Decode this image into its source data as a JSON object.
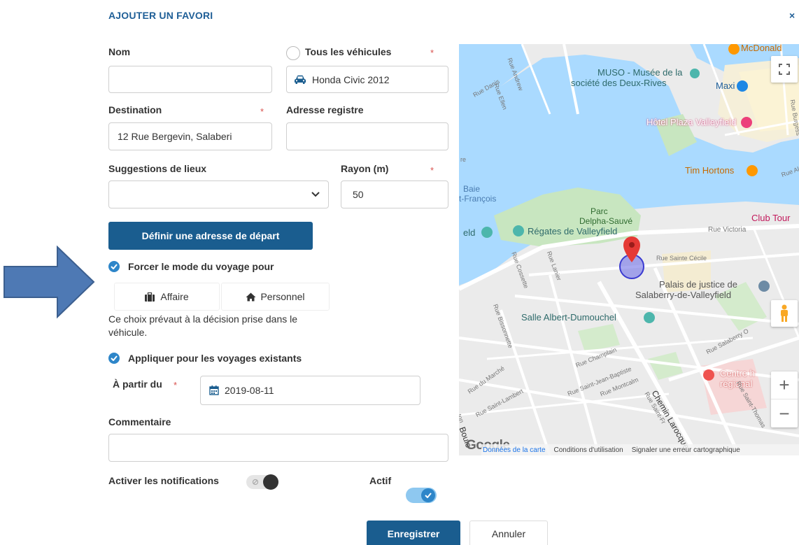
{
  "dialog": {
    "title": "AJOUTER UN FAVORI",
    "close_symbol": "×"
  },
  "form": {
    "name_label": "Nom",
    "name_value": "",
    "all_vehicles_label": "Tous les véhicules",
    "vehicle_value": "Honda Civic 2012",
    "destination_label": "Destination",
    "destination_value": "12 Rue Bergevin, Salaberi",
    "register_address_label": "Adresse registre",
    "register_address_value": "",
    "place_suggestions_label": "Suggestions de lieux",
    "place_suggestions_value": "",
    "radius_label": "Rayon (m)",
    "radius_value": "50",
    "required_mark": "*",
    "set_start_address_button": "Définir une adresse de départ",
    "force_trip_mode_label": "Forcer le mode du voyage pour",
    "trip_mode_business": "Affaire",
    "trip_mode_personal": "Personnel",
    "override_note": "Ce choix prévaut à la décision prise dans le véhicule.",
    "apply_existing_label": "Appliquer pour les voyages existants",
    "from_date_label": "À partir du",
    "from_date_value": "2019-08-11",
    "comment_label": "Commentaire",
    "comment_value": "",
    "notifications_label": "Activer les notifications",
    "active_label": "Actif"
  },
  "footer": {
    "save_button": "Enregistrer",
    "cancel_button": "Annuler"
  },
  "map": {
    "labels": {
      "muso": "MUSO - Musée de la",
      "muso2": "société des Deux-Rives",
      "maxi": "Maxi",
      "mcdonald": "McDonald",
      "hotel": "Hôtel Plaza Valleyfield",
      "tim": "Tim Hortons",
      "baie": "Baie",
      "francois": "t-François",
      "parc": "Parc",
      "parc2": "Delpha-Sauvé",
      "regates": "Régates de Valleyfield",
      "eld": "eld",
      "club": "Club Tour",
      "victoria": "Rue Victoria",
      "palais": "Palais de justice de",
      "palais2": "Salaberry-de-Valleyfield",
      "salle": "Salle Albert-Dumouchel",
      "centre": "Centre h",
      "centre2": "régional",
      "sainte_cecile": "Rue Sainte Cécile",
      "salaberry": "Rue Salaberry O",
      "champlain": "Rue Champlain",
      "stjb": "Rue Saint-Jean-Baptiste",
      "montcalm": "Rue Montcalm",
      "marche": "Rue du Marché",
      "stlambert": "Rue Saint-Lambert",
      "bissonnette": "Rue Bissonnette",
      "cossette": "Rue Cossette",
      "lanier": "Rue Lanier",
      "chemin": "Chemin Larocque",
      "andrew": "Rue Andrew",
      "danis": "Rue Danis",
      "ellen": "Rue Ellen",
      "boule": "Boule",
      "burgess": "Rue Burgess",
      "alph": "Rue Alph",
      "sttho": "Rue Saint-Thomas",
      "saint_frs": "Rue Saint-Fr",
      "re": "re",
      "ton": "ton"
    },
    "attribution": {
      "google": "Google",
      "data": "Données de la carte",
      "terms": "Conditions d'utilisation",
      "report": "Signaler une erreur cartographique"
    },
    "colors": {
      "water": "#aadaff",
      "park": "#c8e6c0",
      "road": "#ffffff",
      "land": "#ebebeb",
      "marker": "#e53935",
      "radius": "#7b7be8"
    },
    "zoom_in": "+",
    "zoom_out": "−"
  },
  "annotation": {
    "arrow_color": "#4e79b4"
  }
}
